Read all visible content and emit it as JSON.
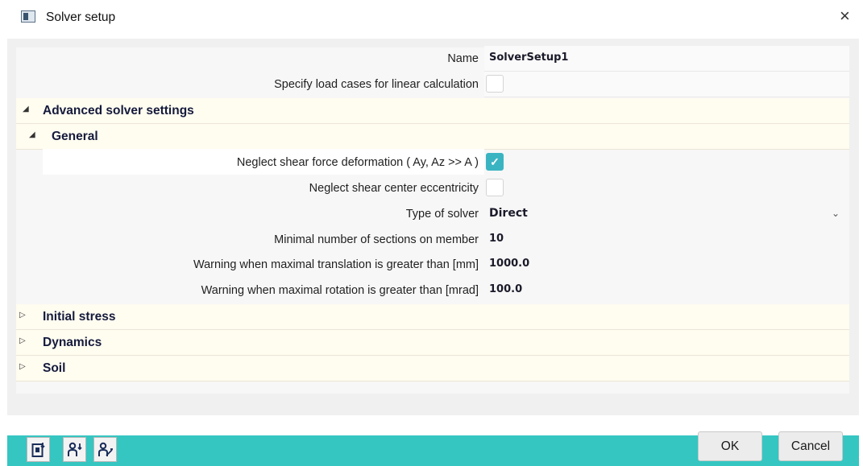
{
  "window": {
    "title": "Solver setup",
    "close_icon": "×"
  },
  "form": {
    "name": {
      "label": "Name",
      "value": "SolverSetup1"
    },
    "specify_load_cases": {
      "label": "Specify load cases for linear calculation",
      "checked": false
    }
  },
  "sections": {
    "advanced": {
      "label": "Advanced solver settings",
      "expanded": true
    },
    "general": {
      "label": "General",
      "expanded": true
    },
    "initial_stress": {
      "label": "Initial stress",
      "expanded": false
    },
    "dynamics": {
      "label": "Dynamics",
      "expanded": false
    },
    "soil": {
      "label": "Soil",
      "expanded": false
    }
  },
  "general": {
    "neglect_shear_deformation": {
      "label": "Neglect shear force deformation ( Ay, Az >> A )",
      "checked": true
    },
    "neglect_shear_center": {
      "label": "Neglect shear center eccentricity",
      "checked": false
    },
    "solver_type": {
      "label": "Type of solver",
      "value": "Direct"
    },
    "min_sections": {
      "label": "Minimal number of sections on member",
      "value": "10"
    },
    "warn_translation": {
      "label": "Warning when maximal translation is greater than [mm]",
      "value": "1000.0"
    },
    "warn_rotation": {
      "label": "Warning when maximal rotation is greater than [mrad]",
      "value": "100.0"
    }
  },
  "icons": {
    "expanded": "◢",
    "collapsed": "▷",
    "dropdown": "⌄",
    "check": "✓"
  },
  "toolbar": {
    "export_icon": "export-document-icon",
    "user_import_icon": "user-import-icon",
    "user_settings_icon": "user-settings-icon"
  },
  "buttons": {
    "ok": "OK",
    "cancel": "Cancel"
  },
  "colors": {
    "accent": "#35c6c2",
    "checkbox_on": "#3bb4c2",
    "section_bg": "#fffcf0"
  }
}
